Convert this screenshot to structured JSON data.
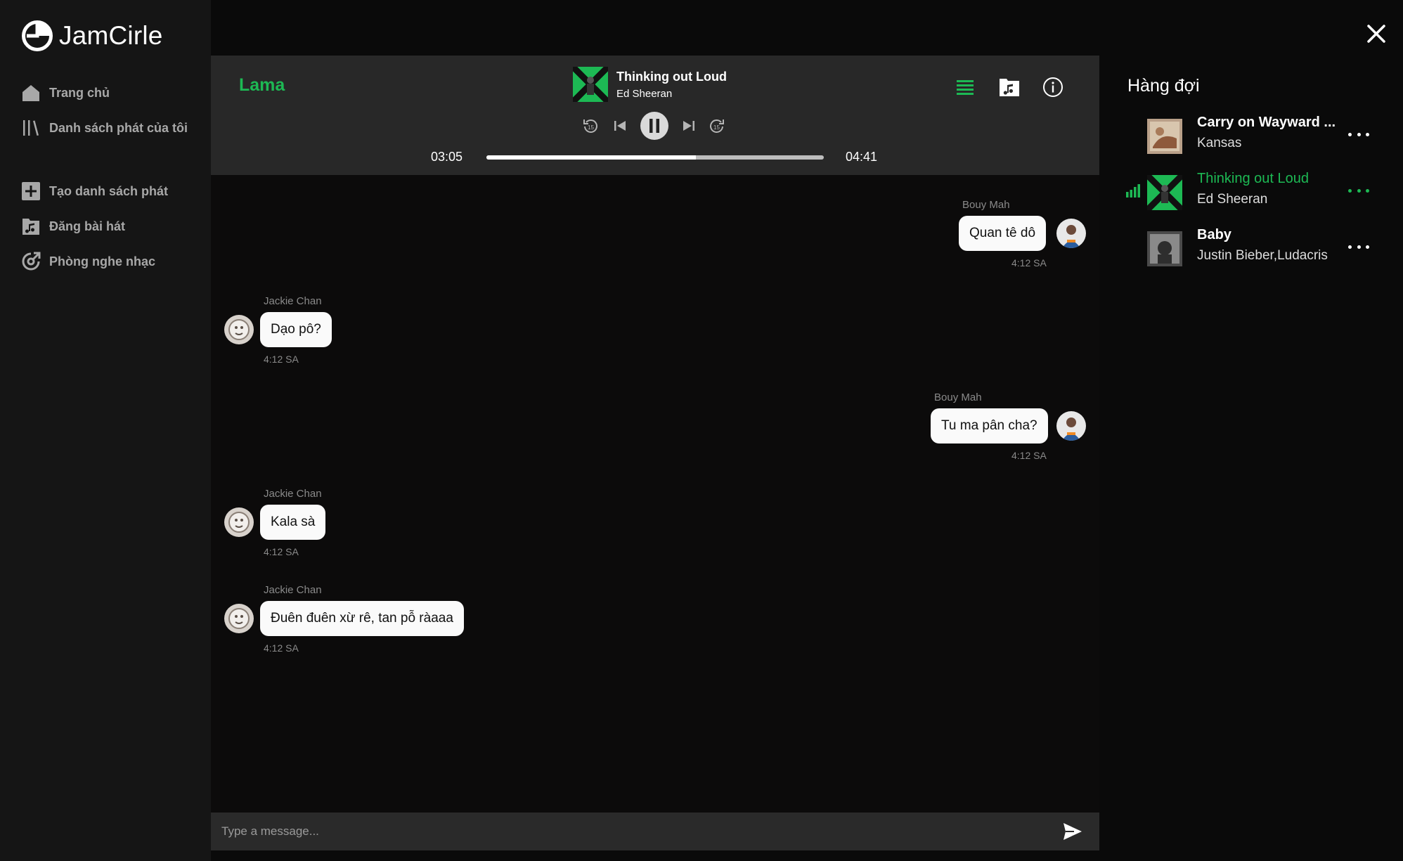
{
  "app": {
    "name": "JamCirle"
  },
  "sidebar": {
    "items": [
      {
        "label": "Trang chủ",
        "icon": "home-icon"
      },
      {
        "label": "Danh sách phát của tôi",
        "icon": "library-icon"
      },
      {
        "label": "Tạo danh sách phát",
        "icon": "add-playlist-icon"
      },
      {
        "label": "Đăng bài hát",
        "icon": "upload-song-icon"
      },
      {
        "label": "Phòng nghe nhạc",
        "icon": "listening-room-icon"
      }
    ]
  },
  "player": {
    "room_name": "Lama",
    "track_title": "Thinking out Loud",
    "track_artist": "Ed Sheeran",
    "current_time": "03:05",
    "total_time": "04:41",
    "progress": 0.62,
    "rewind_seconds": "15",
    "forward_seconds": "15",
    "state": "playing"
  },
  "chat": {
    "messages": [
      {
        "sender": "Bouy Mah",
        "text": "Quan tê dô",
        "time": "4:12 SA",
        "side": "right"
      },
      {
        "sender": "Jackie Chan",
        "text": "Dạo pô?",
        "time": "4:12 SA",
        "side": "left"
      },
      {
        "sender": "Bouy Mah",
        "text": "Tu ma pân cha?",
        "time": "4:12 SA",
        "side": "right"
      },
      {
        "sender": "Jackie Chan",
        "text": "Kala sà",
        "time": "4:12 SA",
        "side": "left"
      },
      {
        "sender": "Jackie Chan",
        "text": "Đuên đuên xừ rê, tan pỗ ràaaa",
        "time": "4:12 SA",
        "side": "left"
      }
    ],
    "input_placeholder": "Type a message..."
  },
  "queue": {
    "title": "Hàng đợi",
    "items": [
      {
        "title": "Carry on Wayward ...",
        "artist": "Kansas",
        "active": false
      },
      {
        "title": "Thinking out Loud",
        "artist": "Ed Sheeran",
        "active": true
      },
      {
        "title": "Baby",
        "artist": "Justin Bieber,Ludacris",
        "active": false
      }
    ]
  },
  "colors": {
    "accent": "#1db954",
    "sidebar_bg": "#151515",
    "player_bg": "#282828",
    "bubble_bg": "#fafafa"
  }
}
